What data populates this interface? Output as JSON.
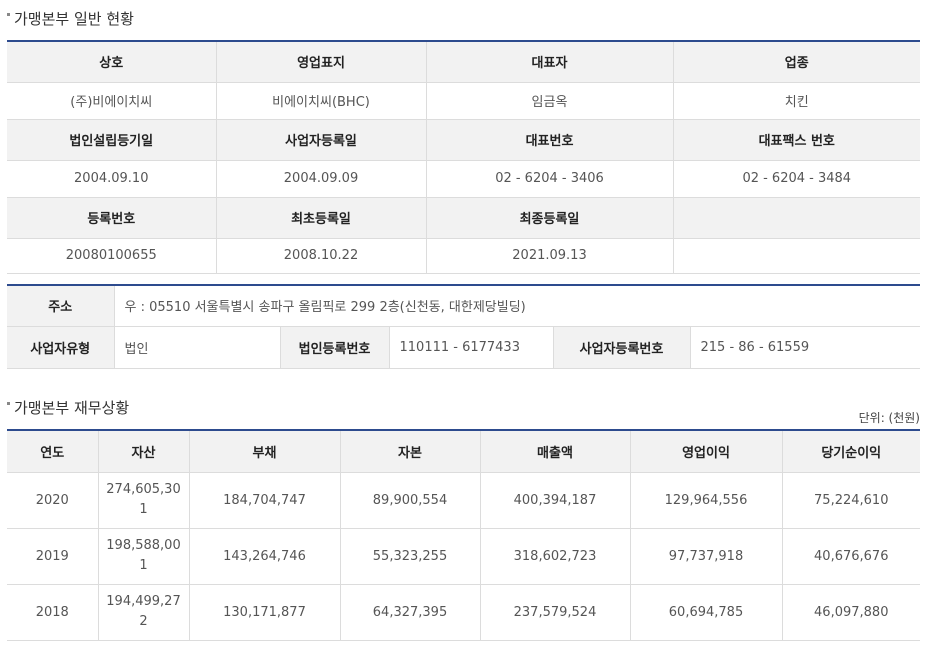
{
  "general": {
    "title": "가맹본부 일반 현황",
    "rows": [
      {
        "headers": [
          "상호",
          "영업표지",
          "대표자",
          "업종"
        ],
        "values": [
          "(주)비에이치씨",
          "비에이치씨(BHC)",
          "임금옥",
          "치킨"
        ]
      },
      {
        "headers": [
          "법인설립등기일",
          "사업자등록일",
          "대표번호",
          "대표팩스 번호"
        ],
        "values": [
          "2004.09.10",
          "2004.09.09",
          "02 - 6204 - 3406",
          "02 - 6204 - 3484"
        ]
      },
      {
        "headers": [
          "등록번호",
          "최초등록일",
          "최종등록일",
          ""
        ],
        "values": [
          "20080100655",
          "2008.10.22",
          "2021.09.13",
          ""
        ]
      }
    ]
  },
  "address": {
    "label": "주소",
    "value": "우 : 05510 서울특별시 송파구 올림픽로 299 2층(신천동, 대한제당빌딩)",
    "biz_type_label": "사업자유형",
    "biz_type_value": "법인",
    "corp_reg_label": "법인등록번호",
    "corp_reg_value": "110111 - 6177433",
    "biz_reg_label": "사업자등록번호",
    "biz_reg_value": "215 - 86 - 61559"
  },
  "finance": {
    "title": "가맹본부 재무상황",
    "unit": "단위: (천원)",
    "headers": [
      "연도",
      "자산",
      "부채",
      "자본",
      "매출액",
      "영업이익",
      "당기순이익"
    ],
    "rows": [
      [
        "2020",
        "274,605,301",
        "184,704,747",
        "89,900,554",
        "400,394,187",
        "129,964,556",
        "75,224,610"
      ],
      [
        "2019",
        "198,588,001",
        "143,264,746",
        "55,323,255",
        "318,602,723",
        "97,737,918",
        "40,676,676"
      ],
      [
        "2018",
        "194,499,272",
        "130,171,877",
        "64,327,395",
        "237,579,524",
        "60,694,785",
        "46,097,880"
      ]
    ]
  },
  "colors": {
    "accent": "#2d4b8e",
    "header_bg": "#f2f2f2",
    "border": "#dcdcdc"
  }
}
